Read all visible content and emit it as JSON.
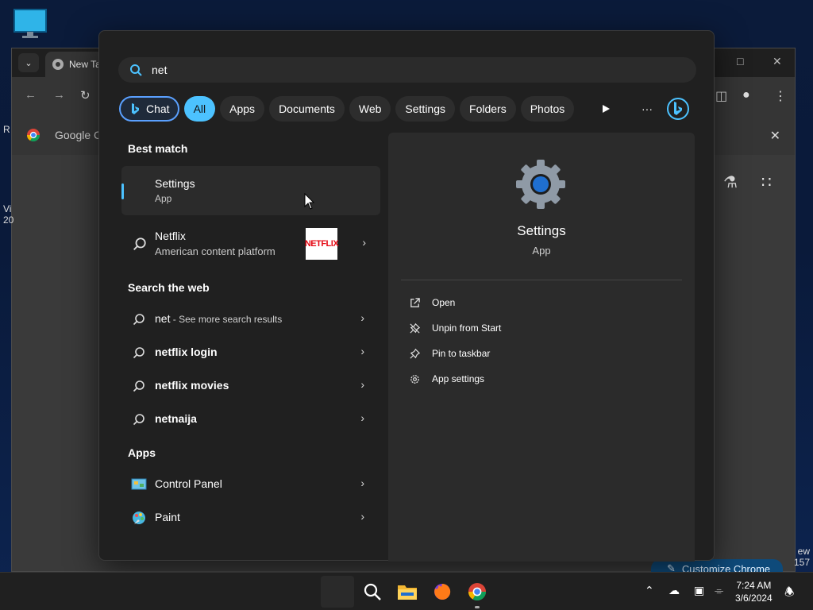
{
  "search": {
    "query": "net"
  },
  "filters": {
    "chat": "Chat",
    "all": "All",
    "apps": "Apps",
    "documents": "Documents",
    "web": "Web",
    "settings": "Settings",
    "folders": "Folders",
    "photos": "Photos",
    "more": "···"
  },
  "best_match": {
    "heading": "Best match",
    "title": "Settings",
    "subtitle": "App"
  },
  "netflix": {
    "title": "Netflix",
    "subtitle": "American content platform",
    "logo_text": "NETFLIX"
  },
  "web": {
    "heading": "Search the web",
    "items": [
      {
        "term": "net",
        "extra": " - See more search results"
      },
      {
        "term": "netflix login",
        "extra": ""
      },
      {
        "term": "netflix movies",
        "extra": ""
      },
      {
        "term": "netnaija",
        "extra": ""
      }
    ]
  },
  "apps": {
    "heading": "Apps",
    "items": [
      {
        "label": "Control Panel"
      },
      {
        "label": "Paint"
      }
    ]
  },
  "preview": {
    "title": "Settings",
    "subtitle": "App",
    "actions": [
      {
        "label": "Open",
        "icon": "open-icon"
      },
      {
        "label": "Unpin from Start",
        "icon": "unpin-icon"
      },
      {
        "label": "Pin to taskbar",
        "icon": "pin-icon"
      },
      {
        "label": "App settings",
        "icon": "gear-icon"
      }
    ]
  },
  "chrome": {
    "tab_title": "New Ta",
    "bookmark": "Google Ch",
    "customize": "Customize Chrome"
  },
  "left_edge": {
    "a": "R",
    "b": "Vi",
    "c": "20"
  },
  "right_edge": {
    "a": "ew",
    "b": "157"
  },
  "clock": {
    "time": "7:24 AM",
    "date": "3/6/2024"
  },
  "colors": {
    "accent": "#4cc2ff",
    "flyout_bg": "#202020",
    "panel_bg": "#2b2b2b"
  }
}
